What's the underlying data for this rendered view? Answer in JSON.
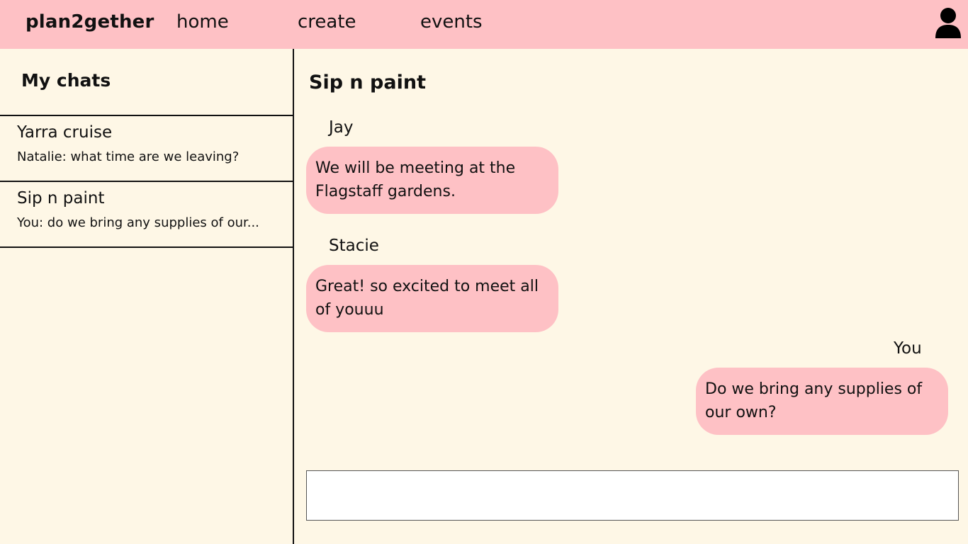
{
  "header": {
    "brand": "plan2gether",
    "nav": [
      {
        "label": "home"
      },
      {
        "label": "create"
      },
      {
        "label": "events"
      }
    ],
    "profile_icon": "user-icon"
  },
  "sidebar": {
    "title": "My chats",
    "chats": [
      {
        "name": "Yarra cruise",
        "preview": "Natalie: what time are we leaving?"
      },
      {
        "name": "Sip n paint",
        "preview": "You: do we bring any supplies of our..."
      }
    ]
  },
  "conversation": {
    "title": "Sip n paint",
    "messages": [
      {
        "sender": "Jay",
        "text": "We will be meeting at the Flagstaff gardens."
      },
      {
        "sender": "Stacie",
        "text": "Great! so excited to meet all of youuu"
      },
      {
        "sender": "You",
        "text": "Do we bring any supplies of our own?"
      }
    ],
    "input": {
      "value": "",
      "placeholder": ""
    }
  },
  "colors": {
    "header_bg": "#fec1c5",
    "page_bg": "#fef7e6",
    "bubble_bg": "#fec1c5"
  }
}
